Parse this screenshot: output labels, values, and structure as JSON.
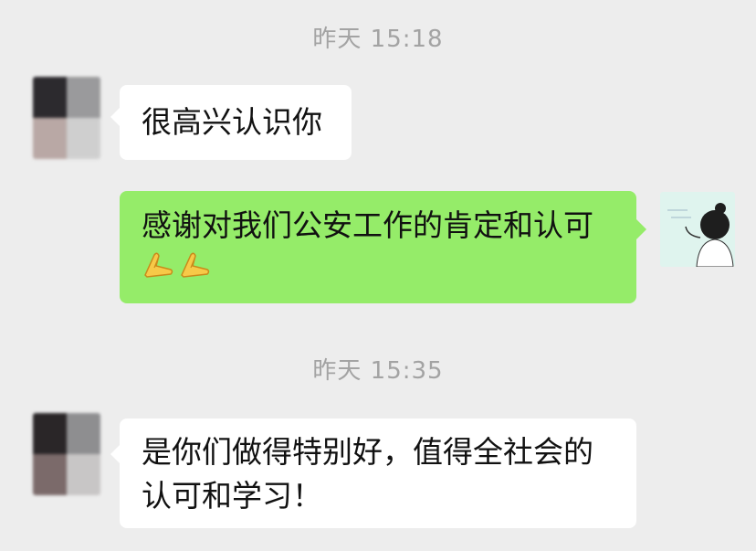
{
  "messages": [
    {
      "type": "timestamp",
      "text": "昨天 15:18"
    },
    {
      "type": "incoming",
      "text": "很高兴认识你"
    },
    {
      "type": "outgoing",
      "text": "感谢对我们公安工作的肯定和认可",
      "emojis": [
        "praying-hands-emoji",
        "praying-hands-emoji"
      ]
    },
    {
      "type": "timestamp",
      "text": "昨天 15:35"
    },
    {
      "type": "incoming",
      "lines": [
        "是你们做得特别好，值得全社会的",
        "认可和学习！"
      ]
    }
  ],
  "colors": {
    "background": "#ededed",
    "incoming_bubble": "#ffffff",
    "outgoing_bubble": "#95ec69",
    "timestamp_text": "#a3a3a3"
  },
  "icons": {
    "contact_avatar": "blurred-avatar",
    "self_avatar": "girl-illustration-avatar",
    "emoji": "praying-hands-emoji"
  }
}
